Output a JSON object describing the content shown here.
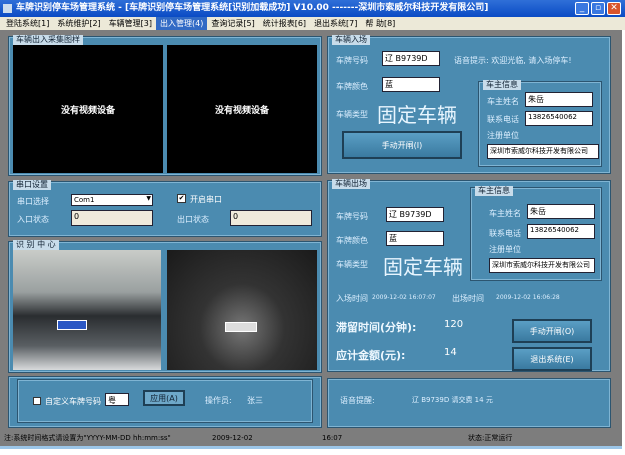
{
  "title": "车牌识别停车场管理系统 - [车牌识别停车场管理系统[识别加载成功]    V10.00          -------深圳市索威尔科技开发有限公司]",
  "menu": [
    "登陆系统[1]",
    "系统维护[2]",
    "车辆管理[3]",
    "出入管理(4)",
    "查询记录[5]",
    "统计报表[6]",
    "退出系统[7]",
    "帮  助[8]"
  ],
  "capture": {
    "legend": "车辆出入采集图样",
    "no_video_1": "没有视频设备",
    "no_video_2": "没有视频设备"
  },
  "serial": {
    "legend": "串口设置",
    "port_label": "串口选择",
    "port_value": "Com1",
    "open_label": "开启串口",
    "open_checked": true,
    "in_label": "入口状态",
    "in_value": "0",
    "out_label": "出口状态",
    "out_value": "0"
  },
  "recog": {
    "legend": "识 别 中 心"
  },
  "custom": {
    "checkbox_label": "自定义车牌号码",
    "plate_prefix": "粤",
    "apply": "应用(A)",
    "operator_label": "操作员:",
    "operator": "张三"
  },
  "entry": {
    "legend": "车辆入场",
    "plate_label": "车牌号码",
    "plate": "辽 B9739D",
    "voice": "语音提示: 欢迎光临, 请入场停车!",
    "color_label": "车牌颜色",
    "color": "蓝",
    "type_label": "车辆类型",
    "type": "固定车辆",
    "open_btn": "手动开闸(I)",
    "owner": {
      "legend": "车主信息",
      "name_label": "车主姓名",
      "name": "朱岳",
      "phone_label": "联系电话",
      "phone": "13826540062",
      "unit_label": "注册单位",
      "unit": "深圳市索威尔科技开发有限公司"
    }
  },
  "exit": {
    "legend": "车辆出场",
    "plate_label": "车牌号码",
    "plate": "辽 B9739D",
    "color_label": "车牌颜色",
    "color": "蓝",
    "type_label": "车辆类型",
    "type": "固定车辆",
    "owner": {
      "legend": "车主信息",
      "name_label": "车主姓名",
      "name": "朱岳",
      "phone_label": "联系电话",
      "phone": "13826540062",
      "unit_label": "注册单位",
      "unit": "深圳市索威尔科技开发有限公司"
    },
    "in_time_label": "入场时间",
    "in_time": "2009-12-02 16:07:07",
    "out_time_label": "出场时间",
    "out_time": "2009-12-02 16:06:28",
    "stay_label": "滞留时间(分钟):",
    "stay": "120",
    "fee_label": "应计金额(元):",
    "fee": "14",
    "open_btn": "手动开闸(O)",
    "exit_btn": "退出系统(E)"
  },
  "voice_panel": {
    "label": "语音提醒:",
    "text": "辽 B9739D 请交费 14 元"
  },
  "status": {
    "note": "注:系统时间格式请设置为\"YYYY-MM-DD hh:mm:ss\"",
    "date": "2009-12-02",
    "time": "16:07",
    "state": "状态:正常运行"
  }
}
